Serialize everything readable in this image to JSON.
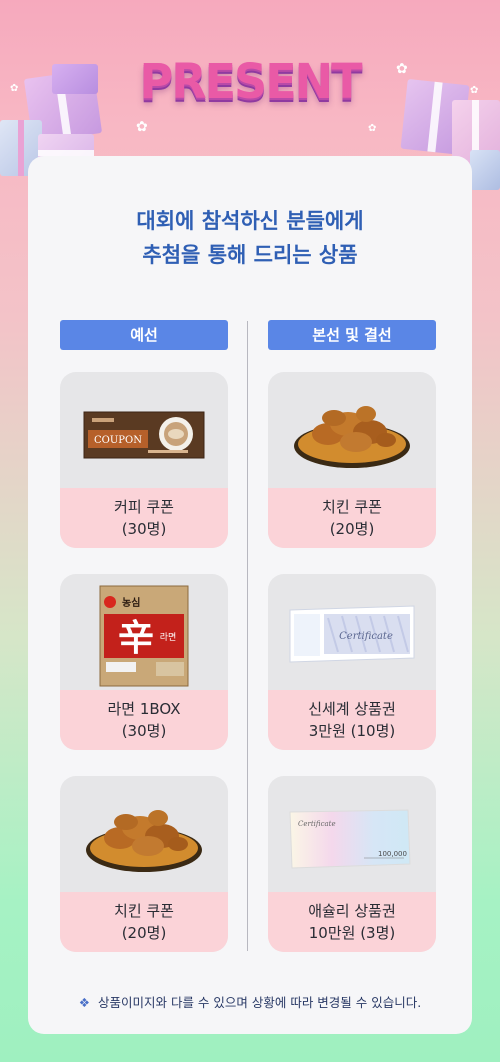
{
  "header": {
    "title": "PRESENT"
  },
  "intro": {
    "line1": "대회에 참석하신 분들에게",
    "line2": "추첨을 통해 드리는 상품"
  },
  "columns": {
    "left": {
      "title": "예선"
    },
    "right": {
      "title": "본선 및 결선"
    }
  },
  "prizes": {
    "left": [
      {
        "line1": "커피 쿠폰",
        "line2": "(30명)",
        "image": "coffee-coupon-image",
        "coupon_text": "COUPON"
      },
      {
        "line1": "라면 1BOX",
        "line2": "(30명)",
        "image": "ramen-box-image",
        "brand_text": "농심",
        "product_char": "辛",
        "product_text": "라면"
      },
      {
        "line1": "치킨 쿠폰",
        "line2": "(20명)",
        "image": "fried-chicken-image"
      }
    ],
    "right": [
      {
        "line1": "치킨 쿠폰",
        "line2": "(20명)",
        "image": "fried-chicken-image"
      },
      {
        "line1": "신세계 상품권",
        "line2": "3만원 (10명)",
        "image": "gift-certificate-image",
        "cert_text": "Certificate"
      },
      {
        "line1": "애슐리 상품권",
        "line2": "10만원 (3명)",
        "image": "gift-card-image",
        "cert_text": "Certificate",
        "amount_text": "100,000"
      }
    ]
  },
  "footnote": {
    "symbol": "❖",
    "text": "상품이미지와 다를 수 있으며 상황에 따라 변경될 수 있습니다."
  },
  "colors": {
    "accent_blue": "#5a86e6",
    "intro_blue": "#2f5fb4",
    "label_pink": "#fbd3d8",
    "title_pink": "#e95aa6"
  }
}
